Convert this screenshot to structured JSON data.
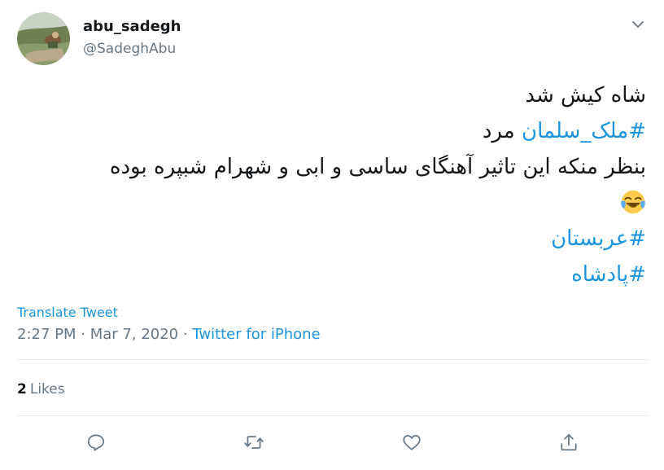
{
  "user": {
    "display_name": "abu_sadegh",
    "handle": "@SadeghAbu"
  },
  "tweet": {
    "line1": "شاه کیش شد",
    "hashtag1": "#ملک_سلمان",
    "line2_rest": "مرد",
    "line3": "بنظر منکه این تاثیر آهنگای ساسی و ابی و شهرام شبپره بوده",
    "emoji": "face-with-tears-of-joy",
    "hashtag2": "#عربستان",
    "hashtag3": "#پادشاه"
  },
  "translate_label": "Translate Tweet",
  "meta": {
    "time": "2:27 PM",
    "separator": "·",
    "date": "Mar 7, 2020",
    "source": "Twitter for iPhone"
  },
  "likes": {
    "count": "2",
    "label": "Likes"
  },
  "actions": [
    "reply-icon",
    "retweet-icon",
    "like-icon",
    "share-icon"
  ],
  "colors": {
    "accent": "#1b95e0",
    "text": "#14171a",
    "secondary": "#657786",
    "divider": "#e6ecf0"
  }
}
